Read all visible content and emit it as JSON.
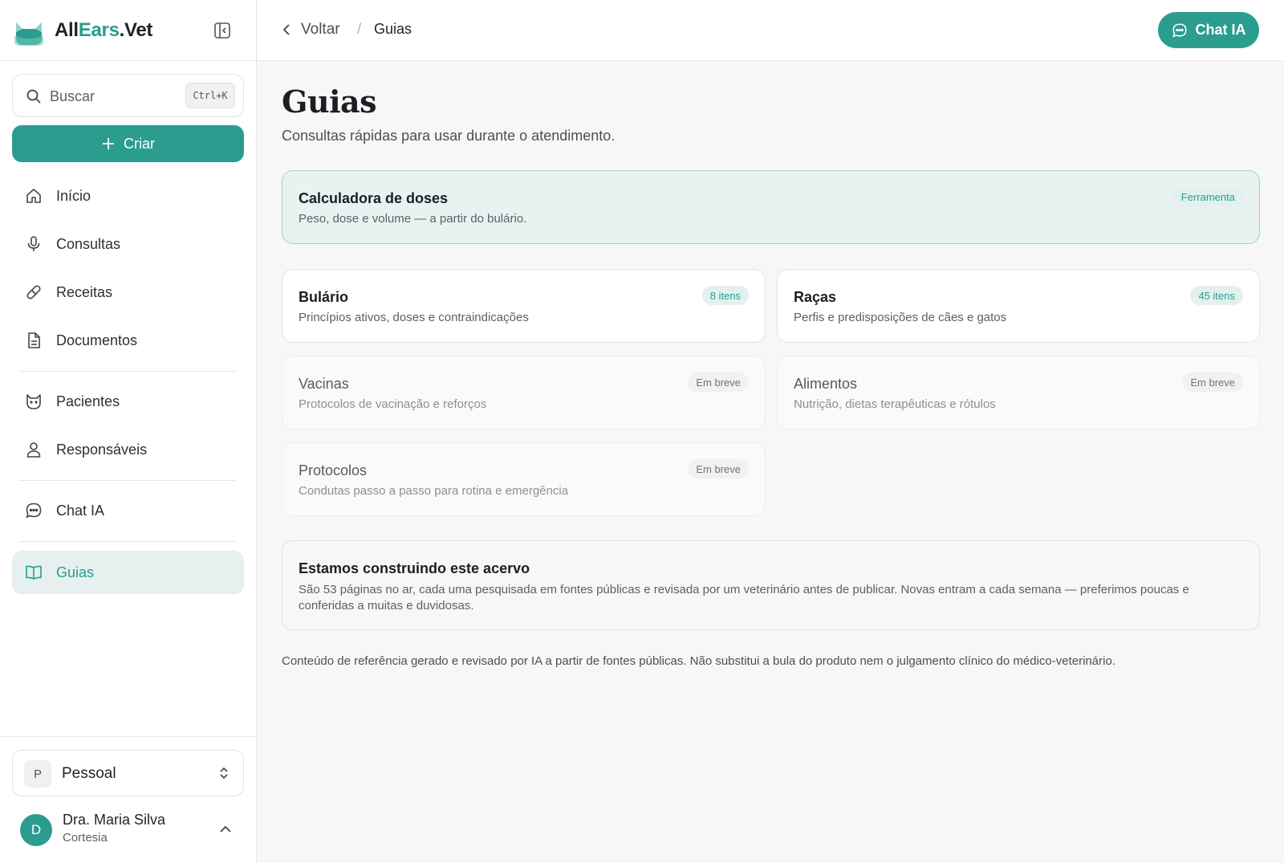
{
  "brand": {
    "part1": "All",
    "part2": "Ears",
    "part3": ".Vet"
  },
  "search": {
    "placeholder": "Buscar",
    "shortcut": "Ctrl+K"
  },
  "create_label": "Criar",
  "nav": {
    "home": "Início",
    "consultations": "Consultas",
    "prescriptions": "Receitas",
    "documents": "Documentos",
    "patients": "Pacientes",
    "guardians": "Responsáveis",
    "chat": "Chat IA",
    "guides": "Guias"
  },
  "workspace": {
    "initial": "P",
    "name": "Pessoal"
  },
  "user": {
    "initial": "D",
    "name": "Dra. Maria Silva",
    "plan": "Cortesia"
  },
  "topbar": {
    "back": "Voltar",
    "separator": "/",
    "current": "Guias",
    "chat_button": "Chat IA"
  },
  "page": {
    "title": "Guias",
    "subtitle": "Consultas rápidas para usar durante o atendimento."
  },
  "cards": {
    "dose_calculator": {
      "title": "Calculadora de doses",
      "desc": "Peso, dose e volume — a partir do bulário.",
      "badge": "Ferramenta"
    },
    "bulario": {
      "title": "Bulário",
      "desc": "Princípios ativos, doses e contraindicações",
      "badge": "8 itens"
    },
    "racas": {
      "title": "Raças",
      "desc": "Perfis e predisposições de cães e gatos",
      "badge": "45 itens"
    },
    "vacinas": {
      "title": "Vacinas",
      "desc": "Protocolos de vacinação e reforços",
      "badge": "Em breve"
    },
    "alimentos": {
      "title": "Alimentos",
      "desc": "Nutrição, dietas terapêuticas e rótulos",
      "badge": "Em breve"
    },
    "protocolos": {
      "title": "Protocolos",
      "desc": "Condutas passo a passo para rotina e emergência",
      "badge": "Em breve"
    }
  },
  "info": {
    "title": "Estamos construindo este acervo",
    "text": "São 53 páginas no ar, cada uma pesquisada em fontes públicas e revisada por um veterinário antes de publicar. Novas entram a cada semana — preferimos poucas e conferidas a muitas e duvidosas."
  },
  "disclaimer": "Conteúdo de referência gerado e revisado por IA a partir de fontes públicas. Não substitui a bula do produto nem o julgamento clínico do médico-veterinário.",
  "colors": {
    "accent": "#2a9d8f",
    "accent_soft": "#e6f0ee",
    "background": "#f7f7f7"
  }
}
